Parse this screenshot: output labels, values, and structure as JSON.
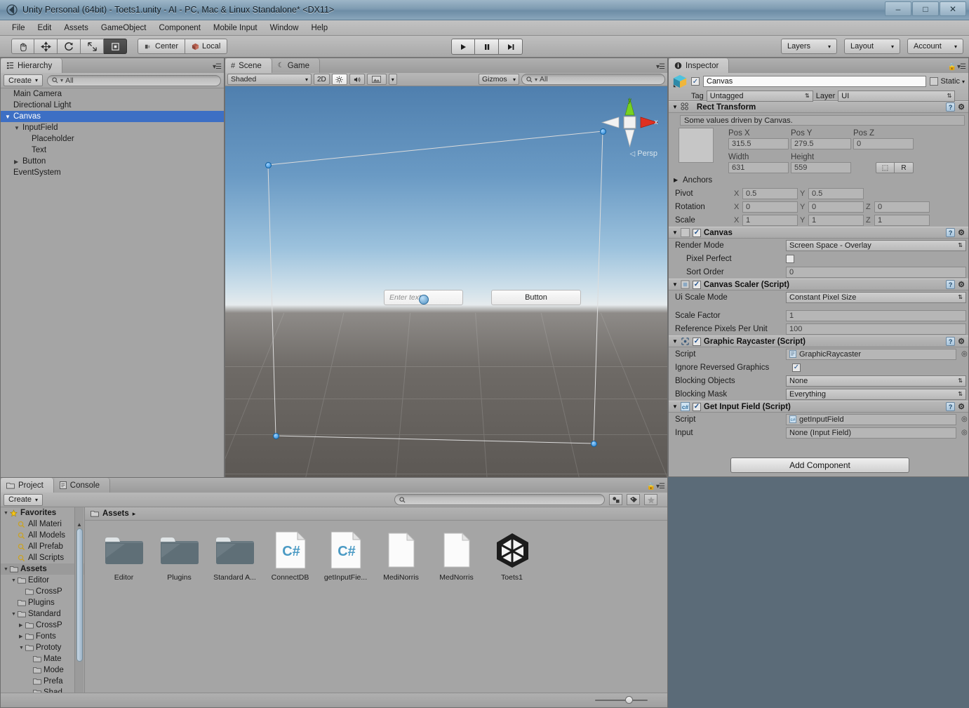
{
  "window": {
    "title": "Unity Personal (64bit) - Toets1.unity - AI - PC, Mac & Linux Standalone* <DX11>",
    "app_icon": "unity-back-icon",
    "minimize": "–",
    "maximize": "□",
    "close": "✕"
  },
  "menubar": {
    "items": [
      "File",
      "Edit",
      "Assets",
      "GameObject",
      "Component",
      "Mobile Input",
      "Window",
      "Help"
    ]
  },
  "toolbar": {
    "tools": [
      {
        "name": "hand-tool",
        "glyph": "✋"
      },
      {
        "name": "move-tool",
        "glyph": "✥"
      },
      {
        "name": "rotate-tool",
        "glyph": "↻"
      },
      {
        "name": "scale-tool",
        "glyph": "⤢"
      },
      {
        "name": "rect-tool",
        "glyph": "⬚"
      }
    ],
    "pivot_label": "Center",
    "local_label": "Local",
    "play": "▶",
    "pause": "❙❙",
    "step": "▶|",
    "layers_label": "Layers",
    "layout_label": "Layout",
    "account_label": "Account",
    "caret": "▾"
  },
  "hierarchy": {
    "tab_label": "Hierarchy",
    "tab_icon": "hierarchy-icon",
    "create_label": "Create",
    "search_placeholder": "All",
    "items": [
      {
        "label": "Main Camera",
        "indent": 0,
        "twisty": "",
        "selected": false
      },
      {
        "label": "Directional Light",
        "indent": 0,
        "twisty": "",
        "selected": false
      },
      {
        "label": "Canvas",
        "indent": 0,
        "twisty": "▼",
        "selected": true
      },
      {
        "label": "InputField",
        "indent": 1,
        "twisty": "▼",
        "selected": false
      },
      {
        "label": "Placeholder",
        "indent": 2,
        "twisty": "",
        "selected": false
      },
      {
        "label": "Text",
        "indent": 2,
        "twisty": "",
        "selected": false
      },
      {
        "label": "Button",
        "indent": 1,
        "twisty": "▶",
        "selected": false
      },
      {
        "label": "EventSystem",
        "indent": 0,
        "twisty": "",
        "selected": false
      }
    ]
  },
  "scene": {
    "tab_scene": "Scene",
    "tab_game": "Game",
    "shading_mode": "Shaded",
    "mode_2d": "2D",
    "lighting_icon": "☀",
    "audio_icon": "◂))",
    "fx_icon": "⛰",
    "gizmos_label": "Gizmos",
    "search_placeholder": "All",
    "persp_label": "Persp",
    "axis_y": "y",
    "axis_x": "x",
    "ui_input_placeholder": "Enter text...",
    "ui_button_label": "Button"
  },
  "inspector": {
    "tab_label": "Inspector",
    "object_name": "Canvas",
    "static_label": "Static",
    "tag_label": "Tag",
    "tag_value": "Untagged",
    "layer_label": "Layer",
    "layer_value": "UI",
    "components": [
      {
        "name": "Rect Transform",
        "has_checkbox": false,
        "note": "Some values driven by Canvas.",
        "fields": {
          "pos_x_label": "Pos X",
          "pos_x": "315.5",
          "pos_y_label": "Pos Y",
          "pos_y": "279.5",
          "pos_z_label": "Pos Z",
          "pos_z": "0",
          "width_label": "Width",
          "width": "631",
          "height_label": "Height",
          "height": "559",
          "blueprint_btn": "⬚",
          "raw_btn": "R",
          "anchors_label": "Anchors",
          "pivot_label": "Pivot",
          "pivot_x": "0.5",
          "pivot_y": "0.5",
          "rotation_label": "Rotation",
          "rot_x": "0",
          "rot_y": "0",
          "rot_z": "0",
          "scale_label": "Scale",
          "scale_x": "1",
          "scale_y": "1",
          "scale_z": "1"
        }
      },
      {
        "name": "Canvas",
        "has_checkbox": true,
        "checked": true,
        "rows": [
          {
            "label": "Render Mode",
            "type": "dropdown",
            "value": "Screen Space - Overlay"
          },
          {
            "label": "Pixel Perfect",
            "type": "checkbox",
            "value": false
          },
          {
            "label": "Sort Order",
            "type": "text",
            "value": "0"
          }
        ]
      },
      {
        "name": "Canvas Scaler (Script)",
        "has_checkbox": true,
        "checked": true,
        "rows": [
          {
            "label": "Ui Scale Mode",
            "type": "dropdown",
            "value": "Constant Pixel Size"
          },
          {
            "label": "Scale Factor",
            "type": "text",
            "value": "1"
          },
          {
            "label": "Reference Pixels Per Unit",
            "type": "text",
            "value": "100"
          }
        ]
      },
      {
        "name": "Graphic Raycaster (Script)",
        "has_checkbox": true,
        "checked": true,
        "rows": [
          {
            "label": "Script",
            "type": "object",
            "value": "GraphicRaycaster"
          },
          {
            "label": "Ignore Reversed Graphics",
            "type": "checkbox",
            "value": true
          },
          {
            "label": "Blocking Objects",
            "type": "dropdown",
            "value": "None"
          },
          {
            "label": "Blocking Mask",
            "type": "dropdown",
            "value": "Everything"
          }
        ]
      },
      {
        "name": "Get Input Field (Script)",
        "has_checkbox": true,
        "checked": true,
        "rows": [
          {
            "label": "Script",
            "type": "object",
            "value": "getInputField"
          },
          {
            "label": "Input",
            "type": "object",
            "value": "None (Input Field)"
          }
        ]
      }
    ],
    "add_component_label": "Add Component"
  },
  "project": {
    "tab_project": "Project",
    "tab_console": "Console",
    "create_label": "Create",
    "search_placeholder": "",
    "breadcrumb": "Assets",
    "breadcrumb_arrow": "▸",
    "tree": [
      {
        "label": "Favorites",
        "indent": 0,
        "twisty": "▼",
        "icon": "star-icon",
        "bold": true
      },
      {
        "label": "All Materi",
        "indent": 1,
        "twisty": "",
        "icon": "search-icon",
        "bold": false
      },
      {
        "label": "All Models",
        "indent": 1,
        "twisty": "",
        "icon": "search-icon",
        "bold": false
      },
      {
        "label": "All Prefab",
        "indent": 1,
        "twisty": "",
        "icon": "search-icon",
        "bold": false
      },
      {
        "label": "All Scripts",
        "indent": 1,
        "twisty": "",
        "icon": "search-icon",
        "bold": false
      },
      {
        "label": "Assets",
        "indent": 0,
        "twisty": "▼",
        "icon": "folder-icon",
        "bold": true,
        "selected": true
      },
      {
        "label": "Editor",
        "indent": 1,
        "twisty": "▼",
        "icon": "folder-icon",
        "bold": false
      },
      {
        "label": "CrossP",
        "indent": 2,
        "twisty": "",
        "icon": "folder-icon",
        "bold": false
      },
      {
        "label": "Plugins",
        "indent": 1,
        "twisty": "",
        "icon": "folder-icon",
        "bold": false
      },
      {
        "label": "Standard",
        "indent": 1,
        "twisty": "▼",
        "icon": "folder-icon",
        "bold": false
      },
      {
        "label": "CrossP",
        "indent": 2,
        "twisty": "▶",
        "icon": "folder-icon",
        "bold": false
      },
      {
        "label": "Fonts",
        "indent": 2,
        "twisty": "▶",
        "icon": "folder-icon",
        "bold": false
      },
      {
        "label": "Prototy",
        "indent": 2,
        "twisty": "▼",
        "icon": "folder-icon",
        "bold": false
      },
      {
        "label": "Mate",
        "indent": 3,
        "twisty": "",
        "icon": "folder-icon",
        "bold": false
      },
      {
        "label": "Mode",
        "indent": 3,
        "twisty": "",
        "icon": "folder-icon",
        "bold": false
      },
      {
        "label": "Prefa",
        "indent": 3,
        "twisty": "",
        "icon": "folder-icon",
        "bold": false
      },
      {
        "label": "Shad",
        "indent": 3,
        "twisty": "",
        "icon": "folder-icon",
        "bold": false
      }
    ],
    "assets": [
      {
        "label": "Editor",
        "kind": "folder"
      },
      {
        "label": "Plugins",
        "kind": "folder"
      },
      {
        "label": "Standard A...",
        "kind": "folder"
      },
      {
        "label": "ConnectDB",
        "kind": "csharp"
      },
      {
        "label": "getInputFie...",
        "kind": "csharp"
      },
      {
        "label": "MediNorris",
        "kind": "file"
      },
      {
        "label": "MedNorris",
        "kind": "file"
      },
      {
        "label": "Toets1",
        "kind": "unity-scene"
      }
    ],
    "toolbar_icons": [
      {
        "name": "filter-type-icon",
        "glyph": "◢"
      },
      {
        "name": "filter-label-icon",
        "glyph": "⬟"
      },
      {
        "name": "filter-favorite-icon",
        "glyph": "★"
      }
    ]
  }
}
